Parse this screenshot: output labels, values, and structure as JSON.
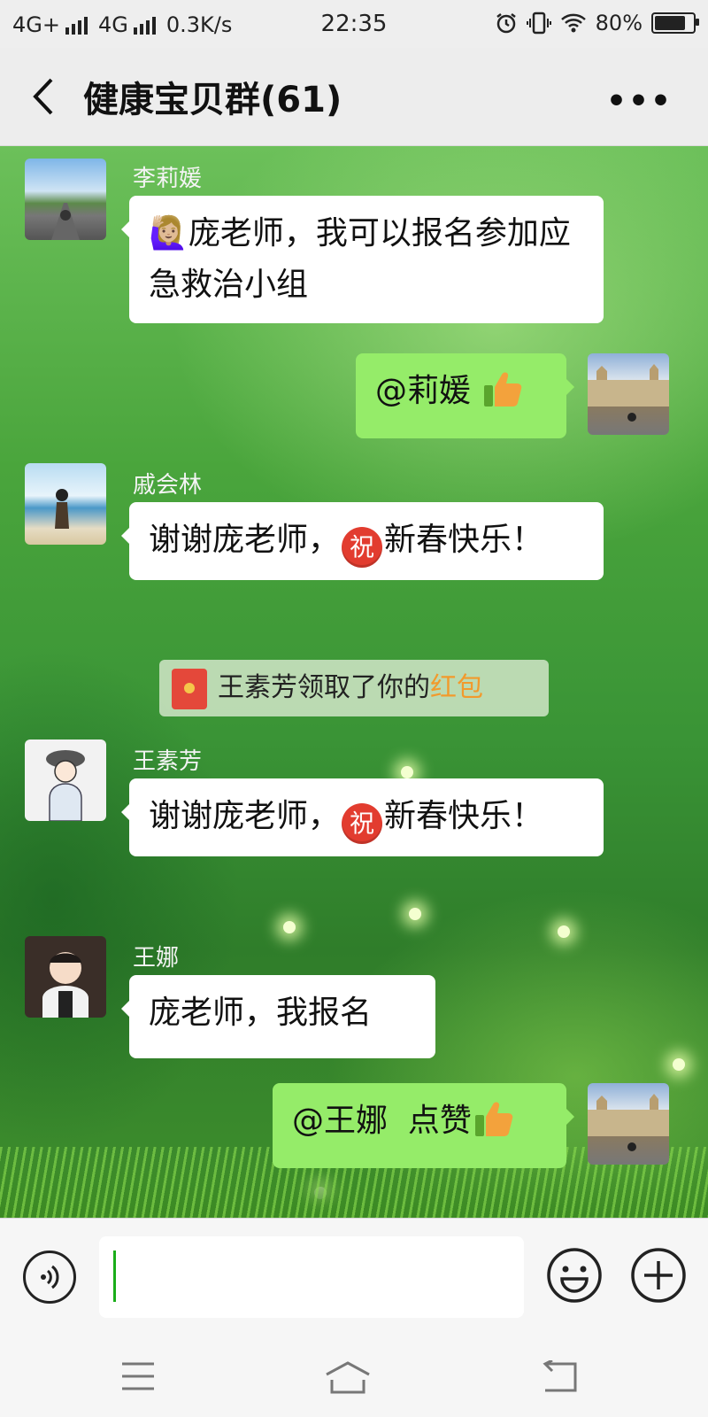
{
  "status_bar": {
    "network1": "4G+",
    "network2": "4G",
    "speed": "0.3K/s",
    "time": "22:35",
    "battery": "80%",
    "battery_level": 0.8
  },
  "header": {
    "title": "健康宝贝群(61)"
  },
  "messages": [
    {
      "sender": "李莉媛",
      "emoji": "🙋🏼‍♀️",
      "text": "庞老师，我可以报名参加应急救治小组"
    },
    {
      "mention": "@莉媛"
    },
    {
      "sender": "戚会林",
      "text_before": "谢谢庞老师，",
      "text_after": "新春快乐！"
    },
    {
      "sender": "王素芳",
      "text_before": "谢谢庞老师，",
      "text_after": "新春快乐！"
    },
    {
      "sender": "王娜",
      "text": "庞老师，我报名"
    },
    {
      "mention": "@王娜",
      "text": "点赞"
    }
  ],
  "emoji_zhu": "祝",
  "system_notice": {
    "text": "王素芳领取了你的",
    "link": "红包"
  },
  "input": {
    "value": ""
  },
  "colors": {
    "self_bubble": "#95ec69",
    "other_bubble": "#ffffff",
    "red_packet_link": "#f29a2c",
    "caret": "#1aad19"
  },
  "icons": [
    "back-icon",
    "more-icon",
    "voice-icon",
    "emoji-icon",
    "plus-icon",
    "menu-icon",
    "home-icon",
    "back-nav-icon",
    "thumbs-up-icon",
    "red-packet-icon"
  ]
}
